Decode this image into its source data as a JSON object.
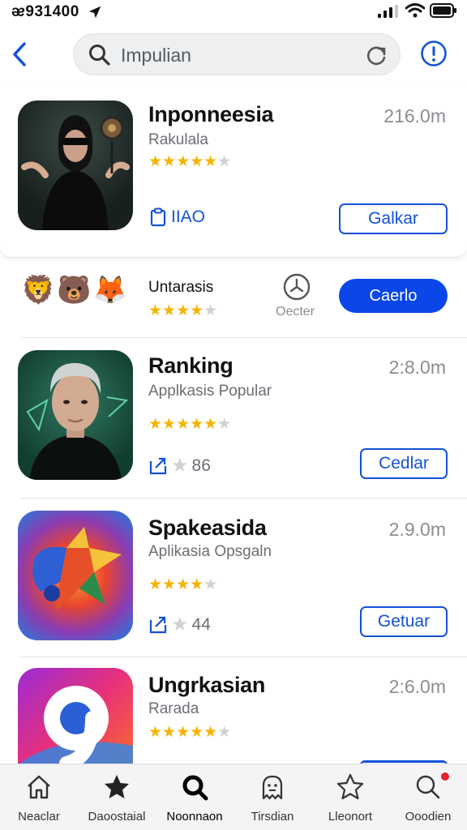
{
  "status_bar": {
    "time": "ᴂ931400"
  },
  "search": {
    "query": "Impulian"
  },
  "apps": [
    {
      "title": "Inponneesia",
      "subtitle": "Rakulala",
      "size": "216.0m",
      "rating": 4,
      "meta_text": "IIAO",
      "meta_icon": "clipboard-icon",
      "button": "Galkar"
    },
    {
      "title": "Ranking",
      "subtitle": "Applkasis Popular",
      "size": "2:8.0m",
      "rating": 4,
      "meta_text": "86",
      "meta_icon": "share-icon",
      "button": "Cedlar"
    },
    {
      "title": "Spakeasida",
      "subtitle": "Aplikasia Opsgaln",
      "size": "2.9.0m",
      "rating": 3.5,
      "meta_text": "44",
      "meta_icon": "share-icon",
      "button": "Getuar"
    },
    {
      "title": "Ungrkasian",
      "subtitle": "Rarada",
      "size": "2:6.0m",
      "rating": 4
    }
  ],
  "ad": {
    "emojis": "🦁🐻🦊",
    "title": "Untarasis",
    "rating": 3.5,
    "caption": "Oecter",
    "button": "Caerlo"
  },
  "tabs": [
    {
      "label": "Neaclar",
      "icon": "home-icon"
    },
    {
      "label": "Daoostaial",
      "icon": "star-filled-icon"
    },
    {
      "label": "Noonnaon",
      "icon": "search-icon",
      "active": true
    },
    {
      "label": "Tirsdian",
      "icon": "ghost-icon"
    },
    {
      "label": "Lleonort",
      "icon": "star-outline-icon"
    },
    {
      "label": "Ooodien",
      "icon": "search-badge-icon",
      "badge": true
    }
  ],
  "colors": {
    "accent": "#1351d8",
    "filled_button": "#0a46e8",
    "star": "#f5b400",
    "badge": "#e8202a"
  }
}
